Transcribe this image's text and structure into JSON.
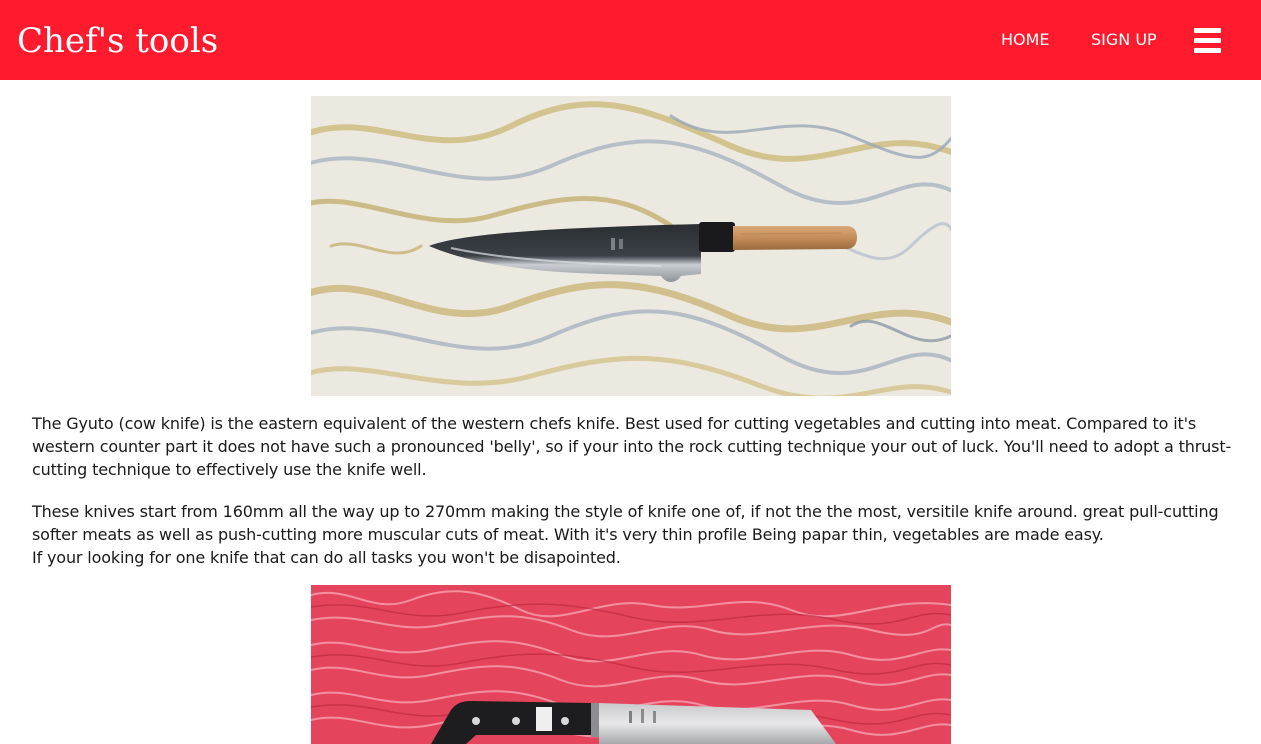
{
  "header": {
    "brand": "Chef's tools",
    "nav": {
      "home": "HOME",
      "signup": "SIGN UP"
    },
    "menu_icon": "hamburger-menu-icon",
    "background_color": "#ff1a2e"
  },
  "content": {
    "image1": {
      "icon": "gyuto-knife-on-marble-photo"
    },
    "paragraph1": "The Gyuto (cow knife) is the eastern equivalent of the western chefs knife. Best used for cutting vegetables and cutting into meat. Compared to it's western counter part it does not have such a pronounced 'belly', so if your into the rock cutting technique your out of luck. You'll need to adopt a thrust-cutting technique to effectively use the knife well.",
    "paragraph2_line1": "These knives start from 160mm all the way up to 270mm making the style of knife one of, if not the the most, versitile knife around. great pull-cutting softer meats as well as push-cutting more muscular cuts of meat. With it's very thin profile Being papar thin, vegetables are made easy.",
    "paragraph2_line2": "If your looking for one knife that can do all tasks you won't be disapointed.",
    "image2": {
      "icon": "santoku-knife-on-red-texture-photo"
    }
  }
}
